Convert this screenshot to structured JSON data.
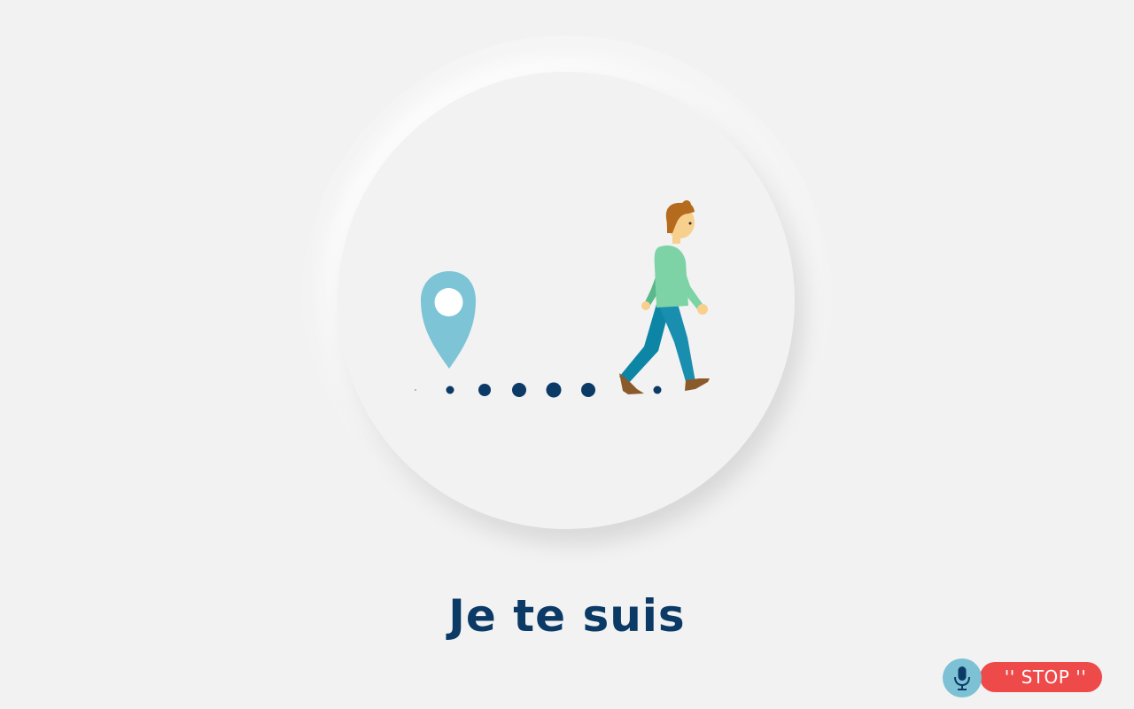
{
  "caption": "Je te suis",
  "illustration": {
    "scene": "walking-person-following-location-pin",
    "pin_color": "#7cc4d6",
    "dots_color": "#0c3a66"
  },
  "voice_control": {
    "stop_label": "'' STOP ''",
    "mic_icon": "microphone-icon",
    "mic_color": "#7cc2d4",
    "stop_color": "#ef4a4a"
  },
  "colors": {
    "background": "#f2f2f2",
    "caption": "#0c3a66"
  }
}
